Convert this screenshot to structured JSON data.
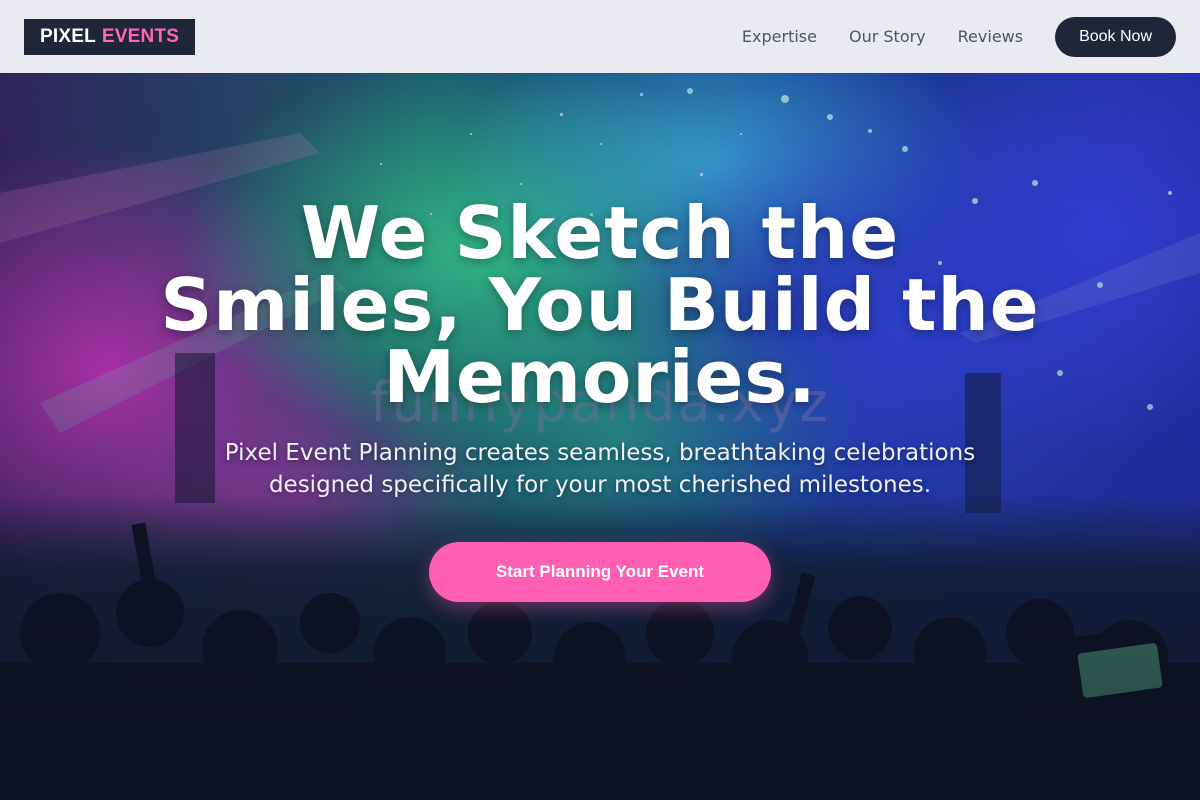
{
  "header": {
    "logo_primary": "PIXEL",
    "logo_accent": "EVENTS",
    "nav": [
      {
        "label": "Expertise"
      },
      {
        "label": "Our Story"
      },
      {
        "label": "Reviews"
      }
    ],
    "book_label": "Book Now"
  },
  "hero": {
    "title": "We Sketch the Smiles, You Build the Memories.",
    "subtitle": "Pixel Event Planning creates seamless, breathtaking celebrations designed specifically for your most cherished milestones.",
    "cta_label": "Start Planning Your Event",
    "watermark": "funnypanda.xyz",
    "background_image": "concert-crowd-image"
  },
  "colors": {
    "brand_dark": "#1e2638",
    "brand_pink": "#ff66b7",
    "cta_pink": "#ff5fb2",
    "header_bg": "#f1f4f8",
    "nav_text": "#4b5566"
  }
}
